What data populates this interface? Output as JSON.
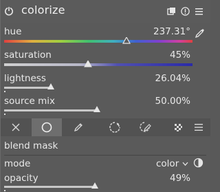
{
  "module": {
    "title": "colorize"
  },
  "sliders": {
    "hue": {
      "label": "hue",
      "value": "237.31°",
      "fraction": 0.66
    },
    "saturation": {
      "label": "saturation",
      "value": "45%",
      "fraction": 0.45
    },
    "lightness": {
      "label": "lightness",
      "value": "26.04%",
      "fraction": 0.26
    },
    "source_mix": {
      "label": "source mix",
      "value": "50.00%",
      "fraction": 0.5
    }
  },
  "blend_modes": {
    "items": [
      "off",
      "uniformly",
      "drawn mask",
      "parametric mask",
      "drawn & parametric mask",
      "raster mask"
    ],
    "selected": "uniformly"
  },
  "blend": {
    "section_title": "blend mask",
    "mode_label": "mode",
    "mode_value": "color",
    "opacity_label": "opacity",
    "opacity_value": "49%",
    "opacity_fraction": 0.49
  },
  "colors": {
    "background": "#5a5a5a",
    "text": "#e9e9e9",
    "selected_button": "#6e6e6e"
  }
}
